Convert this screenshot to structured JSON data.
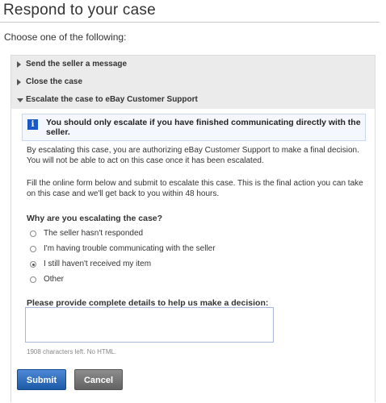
{
  "page": {
    "title": "Respond to your case",
    "subtitle": "Choose one of the following:"
  },
  "accordion": {
    "options": [
      {
        "label": "Send the seller a message",
        "expanded": false,
        "icon": "triangle-right-icon"
      },
      {
        "label": "Close the case",
        "expanded": false,
        "icon": "triangle-right-icon"
      },
      {
        "label": "Escalate the case to eBay Customer Support",
        "expanded": true,
        "icon": "triangle-down-icon"
      }
    ]
  },
  "escalate": {
    "info_icon": "i",
    "alert": "You should only escalate if you have finished communicating directly with the seller.",
    "para1": "By escalating this case, you are authorizing eBay Customer Support to make a final decision. You will not be able to act on this case once it has been escalated.",
    "para2": "Fill the online form below and submit to escalate this case. This is the final action you can take on this case and we'll get back to you within 48 hours.",
    "question": "Why are you escalating the case?",
    "reasons": [
      {
        "label": "The seller hasn't responded",
        "selected": false
      },
      {
        "label": "I'm having trouble communicating with the seller",
        "selected": false
      },
      {
        "label": "I still haven't received my item",
        "selected": true
      },
      {
        "label": "Other",
        "selected": false
      }
    ],
    "details_label": "Please provide complete details to help us make a decision:",
    "details_value": "",
    "chars_left": "1908 characters left. No HTML."
  },
  "buttons": {
    "submit": "Submit",
    "cancel": "Cancel"
  },
  "colors": {
    "accordion_header_bg": "#ebebeb",
    "info_icon_bg": "#1a58c8",
    "submit_bg": "#2c6cc0",
    "cancel_bg": "#777777"
  }
}
